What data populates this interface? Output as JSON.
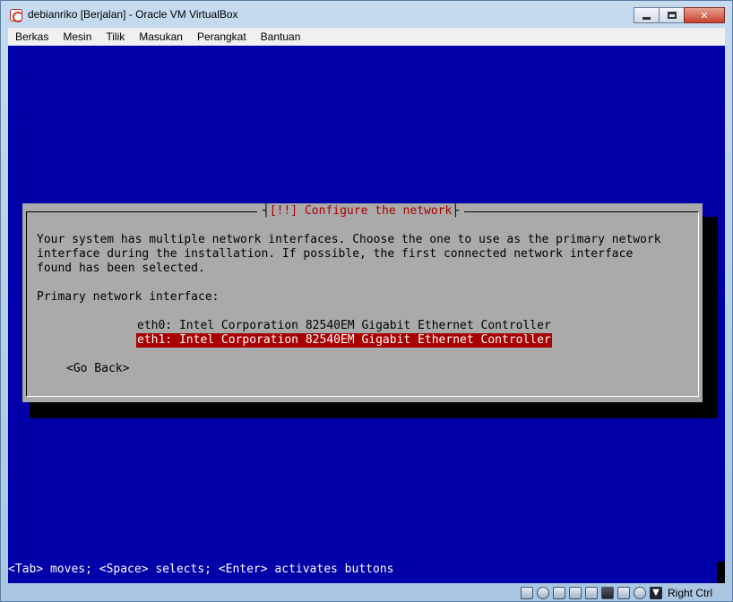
{
  "window": {
    "title": "debianriko [Berjalan] - Oracle VM VirtualBox",
    "minimize_icon": "minimize-icon",
    "maximize_icon": "maximize-icon",
    "close_label": "✕"
  },
  "menubar": {
    "items": [
      {
        "label": "Berkas"
      },
      {
        "label": "Mesin"
      },
      {
        "label": "Tilik"
      },
      {
        "label": "Masukan"
      },
      {
        "label": "Perangkat"
      },
      {
        "label": "Bantuan"
      }
    ]
  },
  "installer": {
    "dialog_title": "[!!] Configure the network",
    "message_lines": [
      "Your system has multiple network interfaces. Choose the one to use as the primary network",
      "interface during the installation. If possible, the first connected network interface",
      "found has been selected."
    ],
    "prompt": "Primary network interface:",
    "options": [
      {
        "label": "eth0: Intel Corporation 82540EM Gigabit Ethernet Controller",
        "selected": false
      },
      {
        "label": "eth1: Intel Corporation 82540EM Gigabit Ethernet Controller",
        "selected": true
      }
    ],
    "back_button": "<Go Back>",
    "help_text": "<Tab> moves; <Space> selects; <Enter> activates buttons",
    "colors": {
      "screen_bg": "#0000a8",
      "dialog_bg": "#aaaaaa",
      "title_fg": "#a80000",
      "selected_bg": "#a80000",
      "selected_fg": "#ffffff"
    }
  },
  "statusbar": {
    "icons": [
      "hard-disk-icon",
      "optical-drive-icon",
      "usb-icon",
      "shared-folder-icon",
      "display-icon",
      "network-icon",
      "video-capture-icon",
      "mouse-integration-icon",
      "host-key-arrow-icon"
    ],
    "host_key": "Right Ctrl"
  }
}
